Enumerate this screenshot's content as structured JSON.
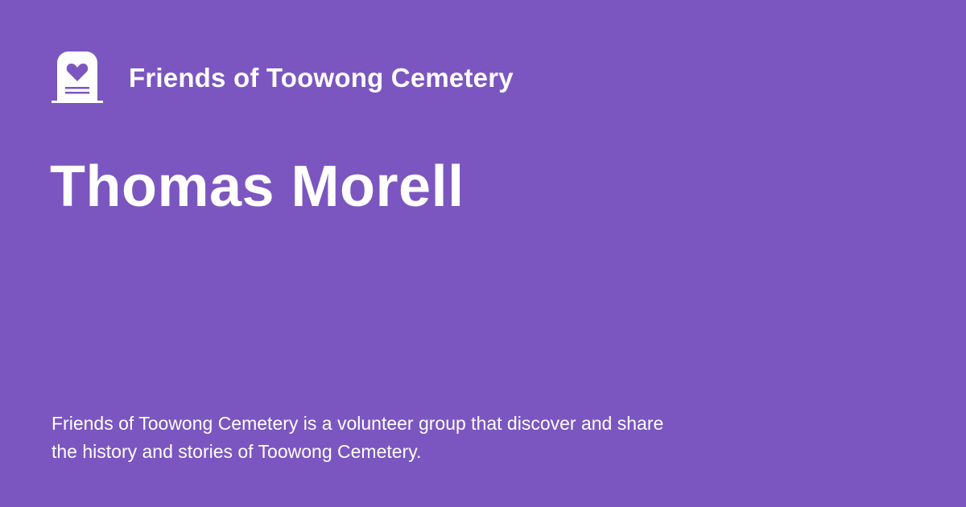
{
  "site": {
    "name": "Friends of Toowong Cemetery",
    "logo_icon": "headstone-heart-icon"
  },
  "page": {
    "title": "Thomas Morell",
    "description": "Friends of Toowong Cemetery is a volunteer group that discover and share the history and stories of Toowong Cemetery."
  },
  "colors": {
    "background": "#7b56c0",
    "text": "#ffffff"
  }
}
